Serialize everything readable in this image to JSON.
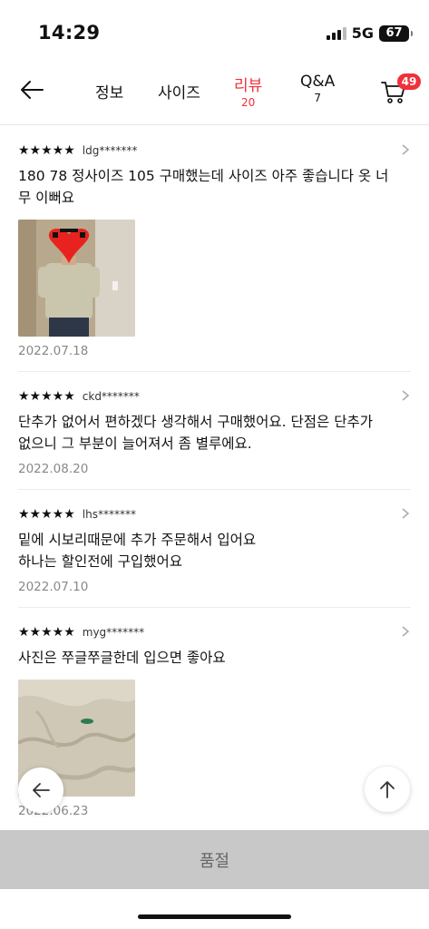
{
  "status": {
    "time": "14:29",
    "network": "5G",
    "battery": "67"
  },
  "header": {
    "tabs": [
      {
        "label": "정보",
        "count": ""
      },
      {
        "label": "사이즈",
        "count": ""
      },
      {
        "label": "리뷰",
        "count": "20"
      },
      {
        "label": "Q&A",
        "count": "7"
      }
    ],
    "cart_badge": "49"
  },
  "reviews": [
    {
      "stars": "★★★★★",
      "user": "ldg*******",
      "text": "180 78 정사이즈 105 구매했는데 사이즈 아주 좋습니다 옷 너\n무 이뻐요",
      "has_photo": true,
      "date": "2022.07.18"
    },
    {
      "stars": "★★★★★",
      "user": "ckd*******",
      "text": "단추가 없어서 편하겠다 생각해서 구매했어요.  단점은 단추가\n없으니 그 부분이 늘어져서 좀 별루에요.",
      "has_photo": false,
      "date": "2022.08.20"
    },
    {
      "stars": "★★★★★",
      "user": "lhs*******",
      "text": "밑에 시보리때문에 추가 주문해서 입어요\n하나는 할인전에 구입했어요",
      "has_photo": false,
      "date": "2022.07.10"
    },
    {
      "stars": "★★★★★",
      "user": "myg*******",
      "text": "사진은 쭈글쭈글한데 입으면 좋아요",
      "has_photo": true,
      "date": "2022.06.23"
    }
  ],
  "bottom": {
    "soldout_label": "품절"
  },
  "colors": {
    "accent": "#f0303a",
    "soldout_bg": "#c8c8c8"
  }
}
